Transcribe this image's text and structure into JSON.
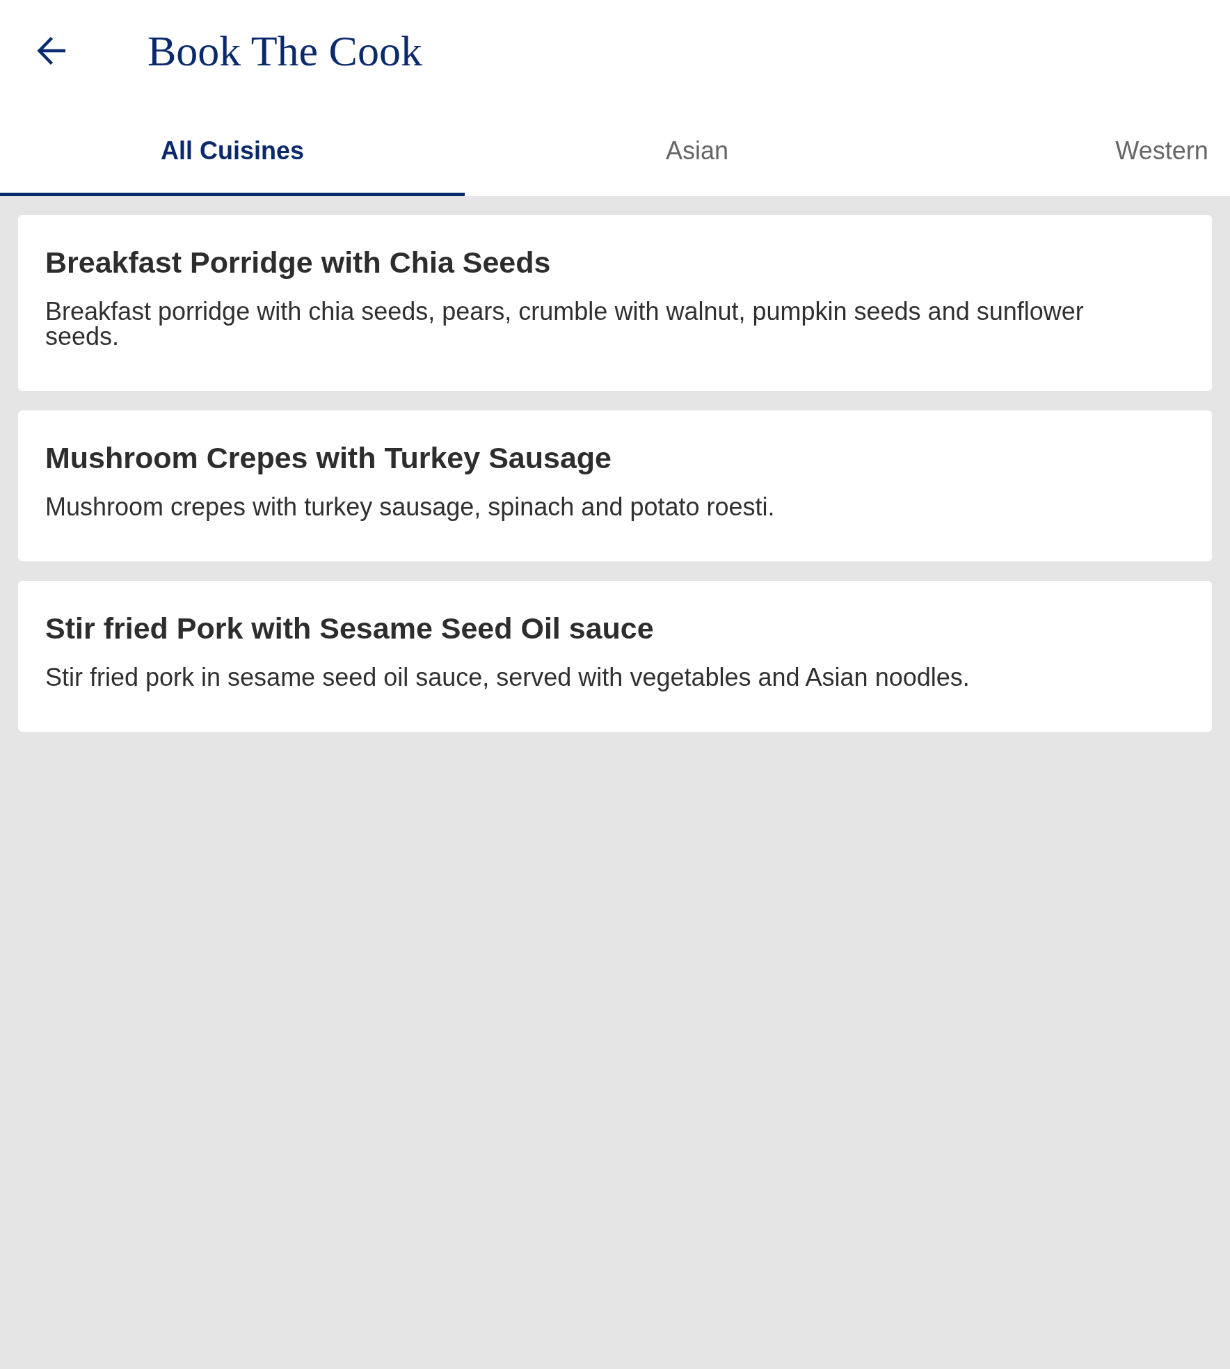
{
  "header": {
    "title": "Book The Cook"
  },
  "tabs": [
    {
      "label": "All Cuisines",
      "selected": true
    },
    {
      "label": "Asian",
      "selected": false
    },
    {
      "label": "Western",
      "selected": false
    }
  ],
  "dishes": [
    {
      "title": "Breakfast Porridge with Chia Seeds",
      "description": "Breakfast porridge with chia seeds, pears, crumble with walnut, pumpkin seeds and sunflower seeds."
    },
    {
      "title": "Mushroom Crepes with Turkey Sausage",
      "description": "Mushroom crepes with turkey sausage, spinach and potato roesti."
    },
    {
      "title": "Stir fried Pork with Sesame Seed Oil sauce",
      "description": "Stir fried pork in sesame seed oil sauce, served with vegetables and Asian noodles."
    }
  ]
}
